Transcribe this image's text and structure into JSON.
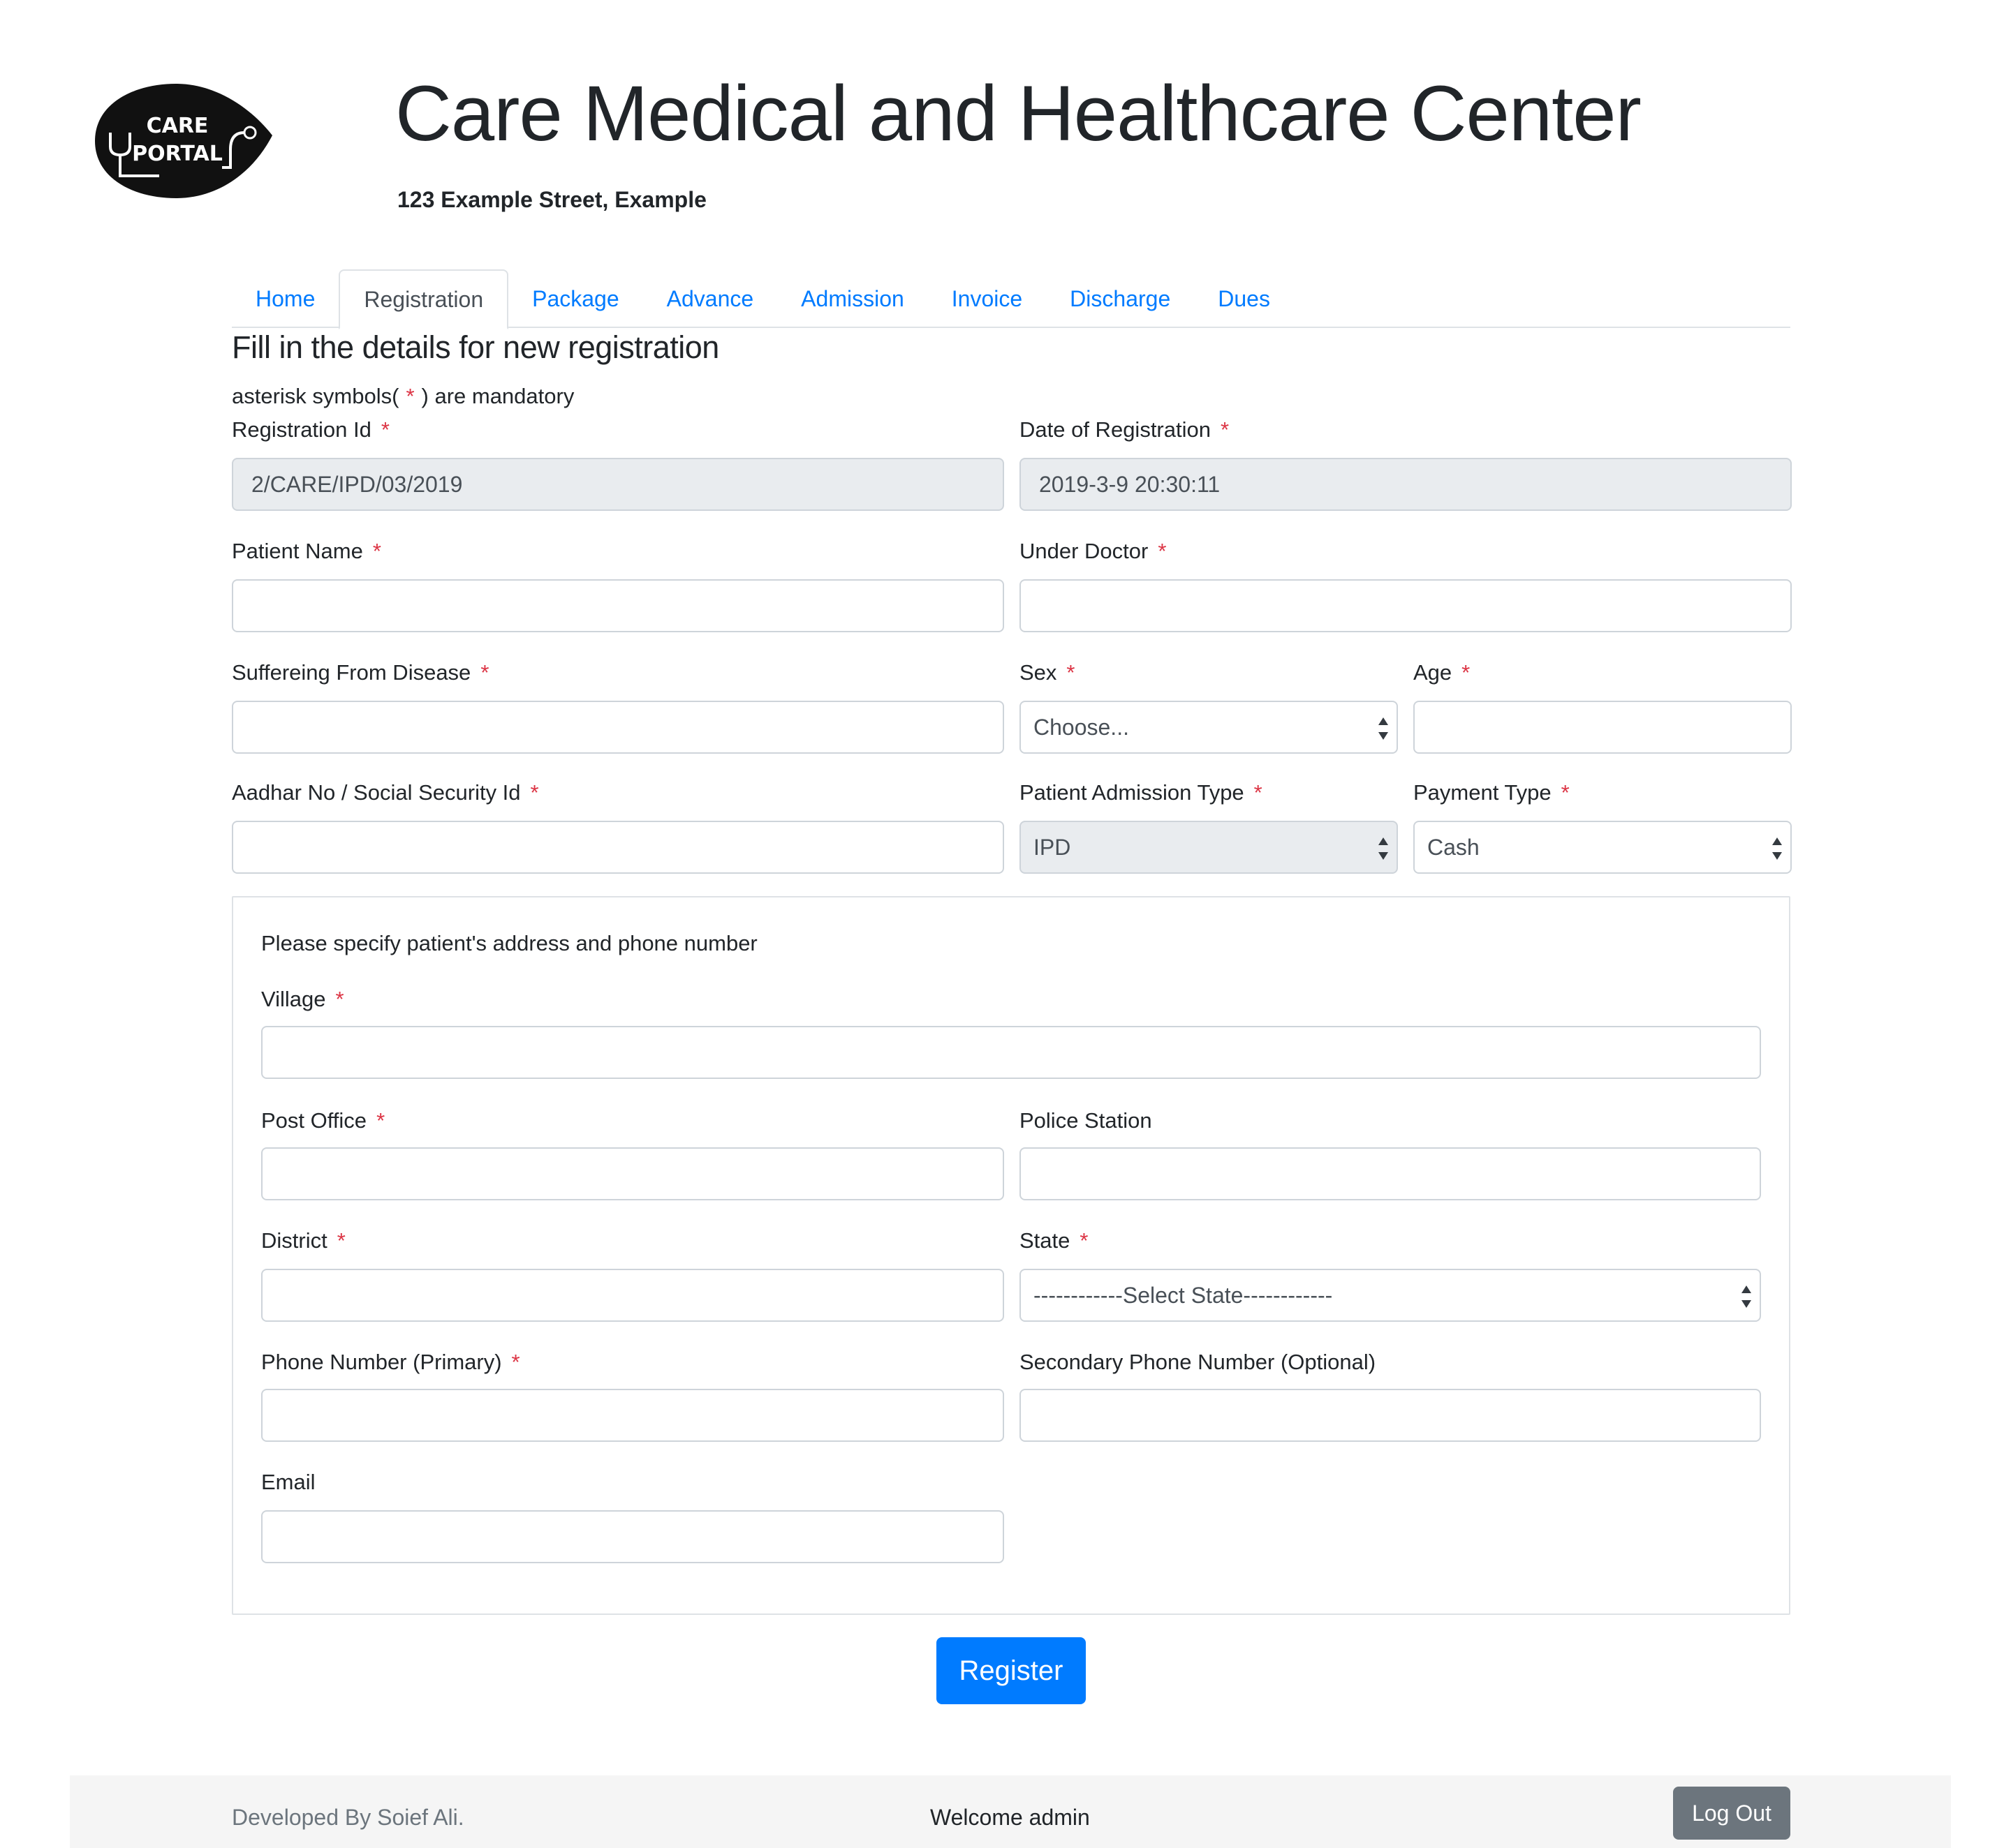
{
  "header": {
    "logo_line1": "CARE",
    "logo_line2": "PORTAL",
    "title": "Care Medical and Healthcare Center",
    "address": "123 Example Street, Example"
  },
  "tabs": [
    {
      "label": "Home",
      "active": false
    },
    {
      "label": "Registration",
      "active": true
    },
    {
      "label": "Package",
      "active": false
    },
    {
      "label": "Advance",
      "active": false
    },
    {
      "label": "Admission",
      "active": false
    },
    {
      "label": "Invoice",
      "active": false
    },
    {
      "label": "Discharge",
      "active": false
    },
    {
      "label": "Dues",
      "active": false
    }
  ],
  "form": {
    "heading": "Fill in the details for new registration",
    "note_before": "asterisk symbols(",
    "note_star": "*",
    "note_after": ") are mandatory",
    "required_mark": "*",
    "registration_id_label": "Registration Id",
    "registration_id_value": "2/CARE/IPD/03/2019",
    "date_label": "Date of Registration",
    "date_value": "2019-3-9 20:30:11",
    "patient_name_label": "Patient Name",
    "under_doctor_label": "Under Doctor",
    "disease_label": "Suffereing From Disease",
    "sex_label": "Sex",
    "sex_value": "Choose...",
    "age_label": "Age",
    "aadhar_label": "Aadhar No / Social Security Id",
    "admission_type_label": "Patient Admission Type",
    "admission_type_value": "IPD",
    "payment_type_label": "Payment Type",
    "payment_type_value": "Cash"
  },
  "address": {
    "intro": "Please specify patient's address and phone number",
    "village_label": "Village",
    "post_office_label": "Post Office",
    "police_station_label": "Police Station",
    "district_label": "District",
    "state_label": "State",
    "state_value": "------------Select State------------",
    "phone_primary_label": "Phone Number (Primary)",
    "phone_secondary_label": "Secondary Phone Number (Optional)",
    "email_label": "Email"
  },
  "register_label": "Register",
  "footer": {
    "developer": "Developed By Soief Ali.",
    "welcome": "Welcome admin",
    "logout_label": "Log Out"
  },
  "colors": {
    "accent": "#007bff",
    "required": "#dc3545",
    "secondary_button": "#6c757d"
  }
}
